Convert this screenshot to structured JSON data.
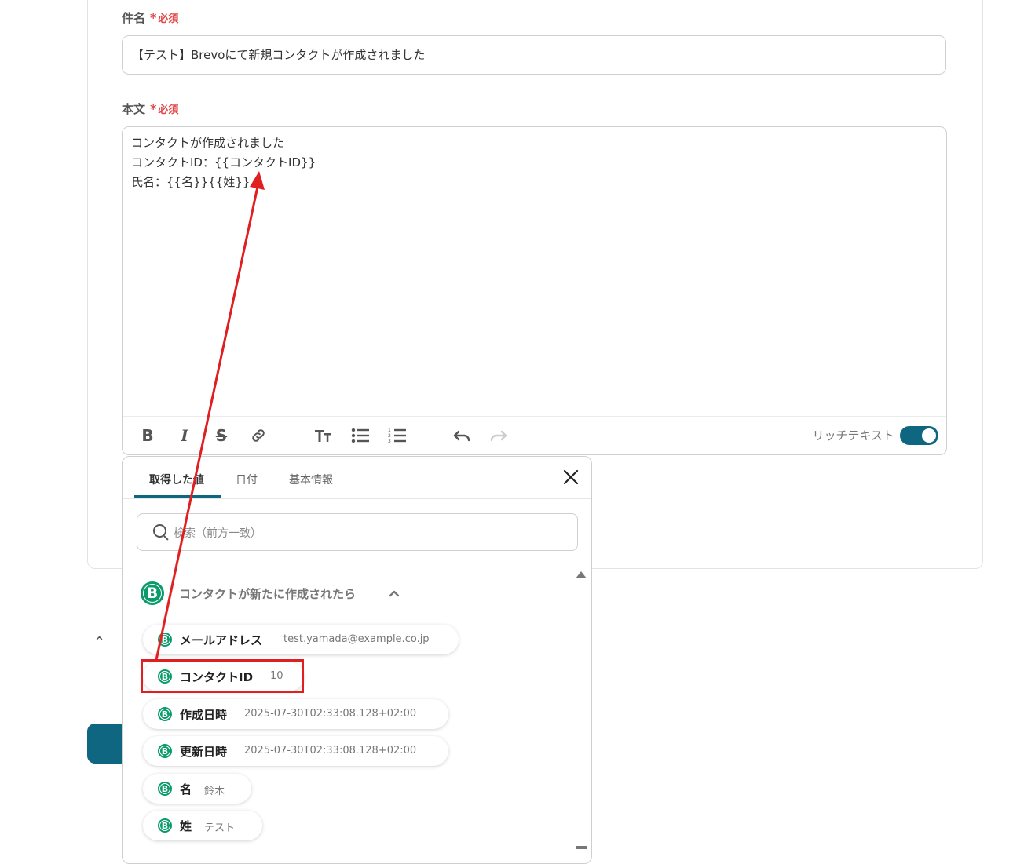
{
  "subject": {
    "label": "件名",
    "required": "必須",
    "value": "【テスト】Brevoにて新規コンタクトが作成されました"
  },
  "body": {
    "label": "本文",
    "required": "必須",
    "lines": [
      "コンタクトが作成されました",
      "コンタクトID：{{コンタクトID}}",
      "氏名：{{名}}{{姓}}"
    ]
  },
  "toolbar": {
    "rich_text_label": "リッチテキスト",
    "rich_text_enabled": true
  },
  "popup": {
    "tabs": [
      {
        "label": "取得した値",
        "active": true
      },
      {
        "label": "日付",
        "active": false
      },
      {
        "label": "基本情報",
        "active": false
      }
    ],
    "search_placeholder": "検索（前方一致）",
    "group": {
      "title": "コンタクトが新たに作成されたら",
      "logo_letter": "B",
      "items": [
        {
          "name": "メールアドレス",
          "value": "test.yamada@example.co.jp"
        },
        {
          "name": "コンタクトID",
          "value": "10",
          "highlighted": true
        },
        {
          "name": "作成日時",
          "value": "2025-07-30T02:33:08.128+02:00"
        },
        {
          "name": "更新日時",
          "value": "2025-07-30T02:33:08.128+02:00"
        },
        {
          "name": "名",
          "value": "鈴木"
        },
        {
          "name": "姓",
          "value": "テスト"
        }
      ]
    }
  },
  "colors": {
    "accent": "#0f6680",
    "required": "#e04848",
    "annotation": "#e02020",
    "brevo_green": "#0b9b6b"
  }
}
